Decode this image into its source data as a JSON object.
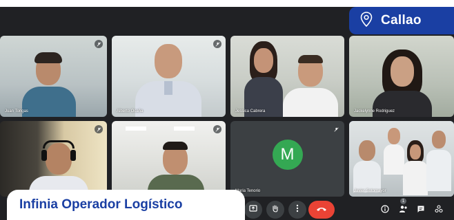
{
  "participants": [
    {
      "name": "Juan Tongas"
    },
    {
      "name": "Alberto Ocaña"
    },
    {
      "name": "Jessica Cabrera"
    },
    {
      "name": "Jackelynne Rodriguez"
    },
    {
      "name": ""
    },
    {
      "name": ""
    },
    {
      "name": "Maria Tenorio",
      "initial": "M"
    },
    {
      "name": "Javier Sotomayor"
    }
  ],
  "overlay": {
    "location_label": "Callao",
    "brand_label": "Infinia Operador Logístico"
  },
  "controls": {
    "raise_hand_count": "1"
  },
  "colors": {
    "meet_background": "#202124",
    "brand_blue": "#1a3fa3",
    "hangup_red": "#ea4335",
    "avatar_green": "#34a853",
    "active_speaker": "#8ab4f8"
  },
  "icons": [
    "location-pin-icon",
    "mic-off-icon",
    "present-icon",
    "raise-hand-icon",
    "more-options-icon",
    "hangup-icon",
    "info-icon",
    "people-icon",
    "chat-icon",
    "activities-icon"
  ]
}
